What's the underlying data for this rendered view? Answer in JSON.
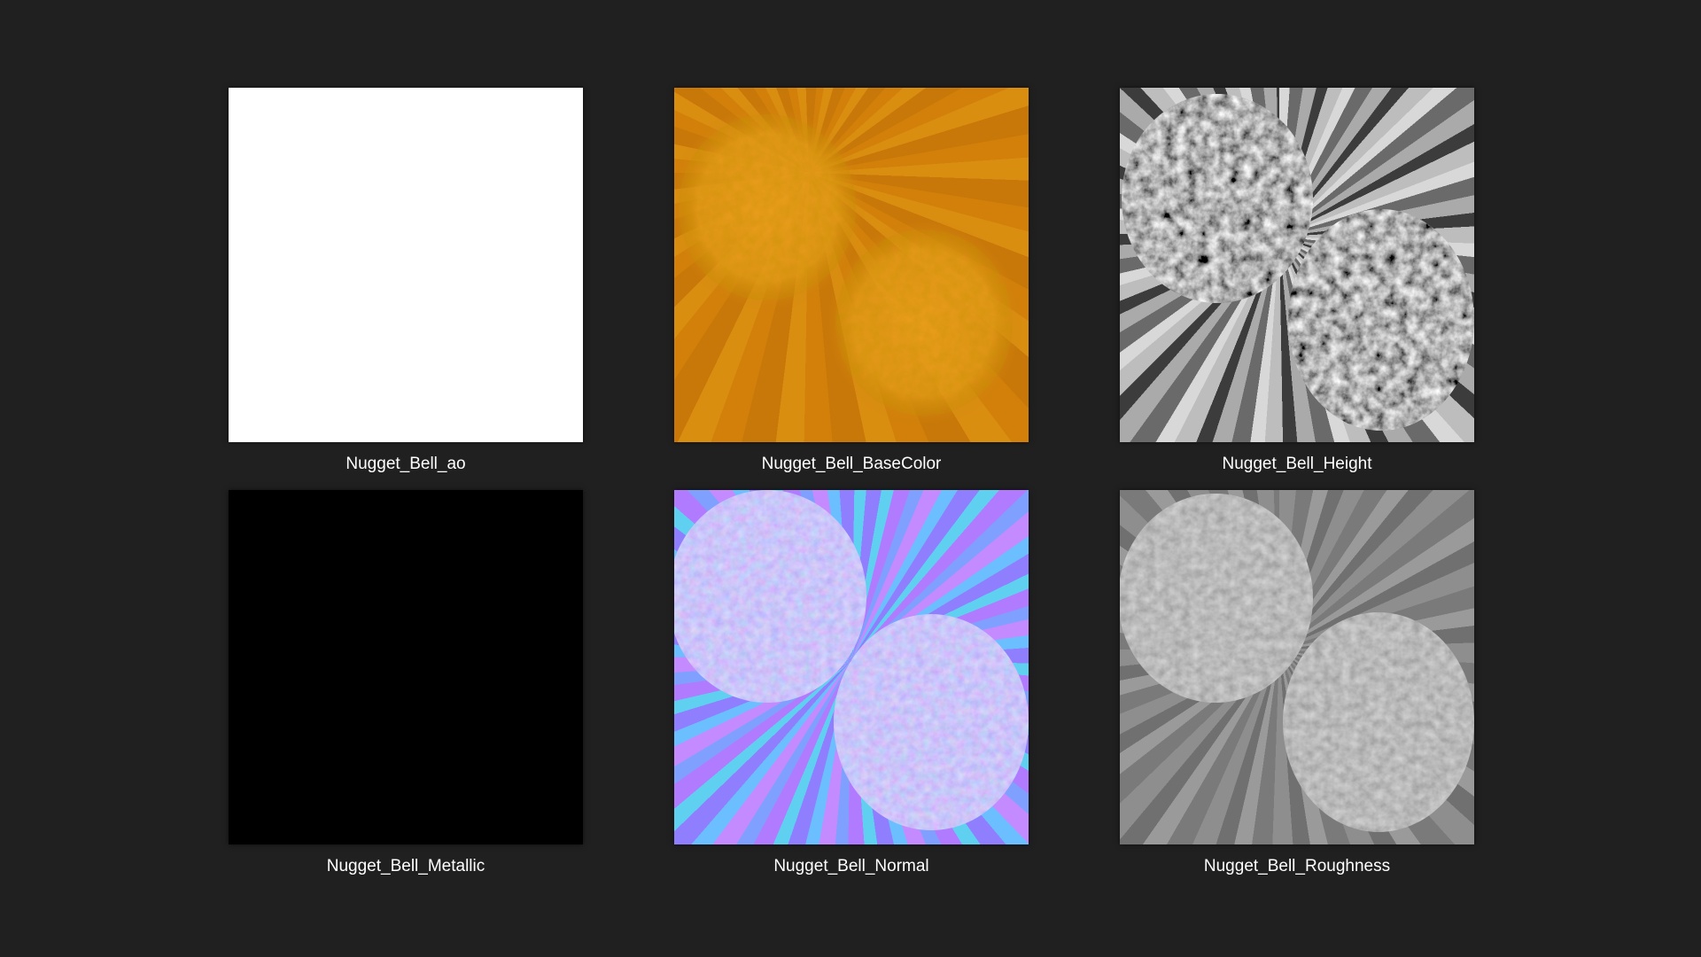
{
  "window": {
    "background": "#202020"
  },
  "files": [
    {
      "name": "Nugget_Bell_ao",
      "map": "ambient-occlusion",
      "swatch": "#ffffff"
    },
    {
      "name": "Nugget_Bell_BaseColor",
      "map": "base-color",
      "swatch": "#d0800a"
    },
    {
      "name": "Nugget_Bell_Height",
      "map": "height",
      "swatch": "#888888"
    },
    {
      "name": "Nugget_Bell_Metallic",
      "map": "metallic",
      "swatch": "#000000"
    },
    {
      "name": "Nugget_Bell_Normal",
      "map": "normal",
      "swatch": "#8080ff"
    },
    {
      "name": "Nugget_Bell_Roughness",
      "map": "roughness",
      "swatch": "#858585"
    }
  ]
}
